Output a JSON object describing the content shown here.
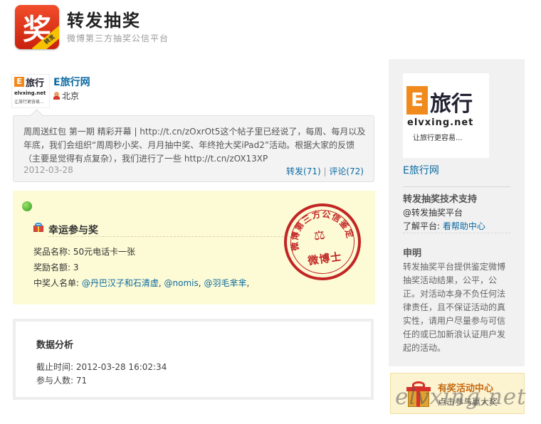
{
  "header": {
    "logo_char": "奖",
    "logo_ribbon": "转发",
    "title": "转发抽奖",
    "subtitle": "微博第三方抽奖公信平台"
  },
  "user": {
    "avatar": {
      "e": "E",
      "name": "旅行",
      "url": "elvxing.net",
      "slogan": "让旅行更容易..."
    },
    "name": "E旅行网",
    "location": "北京"
  },
  "post": {
    "text": "周周送红包 第一期 精彩开幕 | http://t.cn/zOxrOt5这个帖子里已经说了，每周、每月以及年底，我们会组织“周周秒小奖、月月抽中奖、年终抢大奖iPad2”活动。根据大家的反馈（主要是觉得有点复杂），我们进行了一些 http://t.cn/zOX13XP",
    "date": "2012-03-28",
    "repost_label": "转发(71)",
    "separator": "|",
    "comment_label": "评论(72)"
  },
  "result": {
    "title": "幸运参与奖",
    "prize_name_label": "奖品名称:",
    "prize_name": "50元电话卡一张",
    "prize_count_label": "奖励名额:",
    "prize_count": "3",
    "winners_label": "中奖人名单:",
    "winners": [
      "@丹巴汉子和石清虚",
      "@nomis",
      "@羽毛芈芈"
    ],
    "winners_sep": ",",
    "seal": {
      "arc_text": "微博第三方公信鉴定",
      "name": "微博士",
      "color": "#c22525"
    }
  },
  "stats": {
    "title": "数据分析",
    "deadline_label": "截止时间:",
    "deadline": "2012-03-28 16:02:34",
    "participants_label": "参与人数:",
    "participants": "71"
  },
  "sidebar": {
    "avatar": {
      "e": "E",
      "name": "旅行",
      "url": "elvxing.net",
      "slogan": "让旅行更容易..."
    },
    "name": "E旅行网",
    "support_title": "转发抽奖技术支持",
    "support_link": "@转发抽奖平台",
    "learn_label": "了解平台:",
    "learn_link": "看帮助中心",
    "notice_title": "申明",
    "notice_text": "转发抽奖平台提供鉴定微博抽奖活动结果，公平，公正。对活动本身不负任何法律责任，且不保证活动的真实性，请用户尽量参与可信任的或已加新浪认证用户发起的活动。"
  },
  "promo": {
    "title": "有奖活动中心",
    "subtitle": "点击参与赢大奖"
  },
  "watermark": "elvxing.net",
  "colors": {
    "link": "#0a6aa1",
    "result_bg": "#fdfbd5",
    "sidebar_bg": "#f1f1f1",
    "accent_red": "#c22525"
  }
}
